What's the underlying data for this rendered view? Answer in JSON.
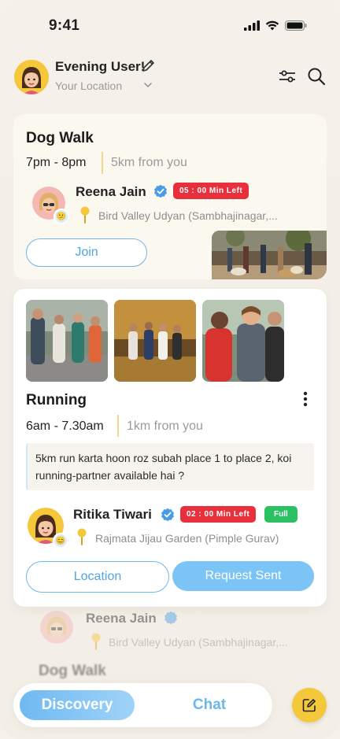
{
  "status_bar": {
    "time": "9:41"
  },
  "header": {
    "username": "Evening User!",
    "location": "Your Location"
  },
  "cards": [
    {
      "title": "Dog Walk",
      "time": "7pm - 8pm",
      "distance": "5km from you",
      "host": "Reena Jain",
      "badge": "05 : 00 Min Left",
      "place": "Bird Valley Udyan (Sambhajinagar,...",
      "join_label": "Join"
    },
    {
      "title": "Running",
      "time": "6am - 7.30am",
      "distance": "1km from you",
      "note": "5km run karta hoon roz subah place 1 to place 2, koi running-partner available hai ?",
      "host": "Ritika Tiwari",
      "badge": "02 : 00 Min Left",
      "status": "Full",
      "place": "Rajmata Jijau Garden (Pimple Gurav)",
      "location_label": "Location",
      "request_label": "Request Sent"
    },
    {
      "title": "Dog Walk",
      "host": "Reena Jain",
      "place": "Bird Valley Udyan (Sambhajinagar,..."
    }
  ],
  "nav": {
    "discovery": "Discovery",
    "chat": "Chat"
  },
  "colors": {
    "accent_blue": "#6fb6ec",
    "yellow": "#f5c73a",
    "red": "#e8303d",
    "green": "#2bc163"
  }
}
